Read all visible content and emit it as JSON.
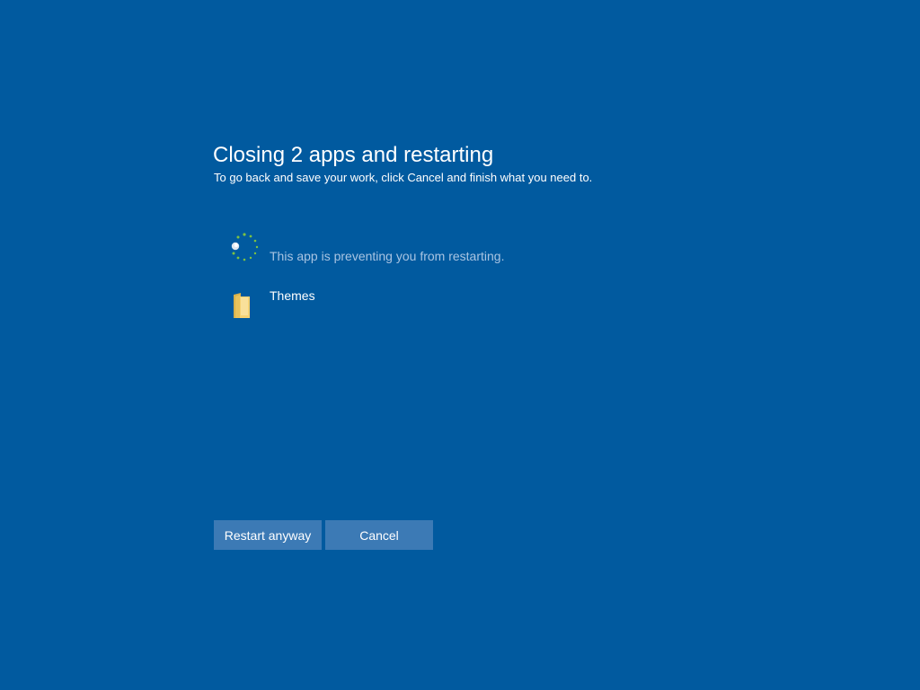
{
  "dialog": {
    "title": "Closing 2 apps and restarting",
    "subtitle": "To go back and save your work, click Cancel and finish what you need to."
  },
  "status": {
    "text": "This app is preventing you from restarting.",
    "icon": "loading-spinner-icon"
  },
  "apps": [
    {
      "name": "Themes",
      "icon": "folder-icon"
    }
  ],
  "buttons": {
    "restart_label": "Restart anyway",
    "cancel_label": "Cancel"
  },
  "colors": {
    "background": "#015a9f",
    "button": "#3c7ab5",
    "status_text": "#a9c4e2",
    "spinner_dot": "#7dc242",
    "folder": "#f5d274"
  }
}
